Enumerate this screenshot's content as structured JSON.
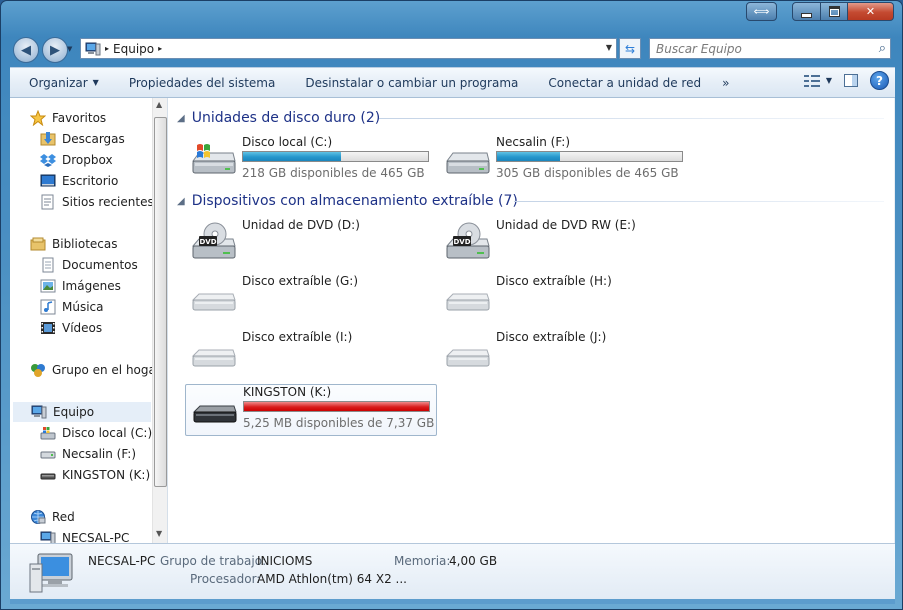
{
  "window": {
    "caption_buttons": {
      "extra": "⟺",
      "close": "✕"
    }
  },
  "address": {
    "root_sep": "▸",
    "crumbs": [
      {
        "label": "Equipo"
      }
    ],
    "trail_sep": "▸",
    "search_placeholder": "Buscar Equipo"
  },
  "toolbar": {
    "organize": "Organizar",
    "system_properties": "Propiedades del sistema",
    "uninstall": "Desinstalar o cambiar un programa",
    "map_drive": "Conectar a unidad de red",
    "more": "»",
    "help": "?"
  },
  "nav": {
    "favorites": "Favoritos",
    "downloads": "Descargas",
    "dropbox": "Dropbox",
    "desktop": "Escritorio",
    "recent": "Sitios recientes",
    "libraries": "Bibliotecas",
    "documents": "Documentos",
    "pictures": "Imágenes",
    "music": "Música",
    "videos": "Vídeos",
    "homegroup": "Grupo en el hogar",
    "computer": "Equipo",
    "local_disk": "Disco local (C:)",
    "necsalin": "Necsalin (F:)",
    "kingston": "KINGSTON (K:)",
    "network": "Red",
    "pc": "NECSAL-PC"
  },
  "groups": {
    "hard_disks": "Unidades de disco duro (2)",
    "removable": "Dispositivos con almacenamiento extraíble (7)"
  },
  "drives": {
    "c": {
      "name": "Disco local (C:)",
      "free": "218 GB disponibles de 465 GB",
      "used_fraction": 0.53
    },
    "f": {
      "name": "Necsalin (F:)",
      "free": "305 GB disponibles de 465 GB",
      "used_fraction": 0.34
    },
    "d": {
      "name": "Unidad de DVD (D:)"
    },
    "e": {
      "name": "Unidad de DVD RW (E:)"
    },
    "g": {
      "name": "Disco extraíble (G:)"
    },
    "h": {
      "name": "Disco extraíble (H:)"
    },
    "i": {
      "name": "Disco extraíble (I:)"
    },
    "j": {
      "name": "Disco extraíble (J:)"
    },
    "k": {
      "name": "KINGSTON (K:)",
      "free": "5,25 MB disponibles de 7,37 GB",
      "used_fraction": 0.999
    }
  },
  "details": {
    "pc_name": "NECSAL-PC",
    "workgroup_label": "Grupo de trabajo:",
    "workgroup": "INICIOMS",
    "memory_label": "Memoria:",
    "memory": "4,00 GB",
    "processor_label": "Procesador:",
    "processor": "AMD Athlon(tm) 64 X2 ..."
  },
  "icons": [
    "back-icon",
    "forward-icon",
    "computer-icon",
    "refresh-icon",
    "search-icon",
    "views-icon",
    "preview-pane-icon",
    "help-icon",
    "star-icon",
    "folder-icon",
    "dropbox-icon",
    "desktop-icon",
    "library-icon",
    "homegroup-icon",
    "network-icon",
    "hard-disk-icon",
    "windows-disk-icon",
    "dvd-icon",
    "usb-drive-icon"
  ]
}
